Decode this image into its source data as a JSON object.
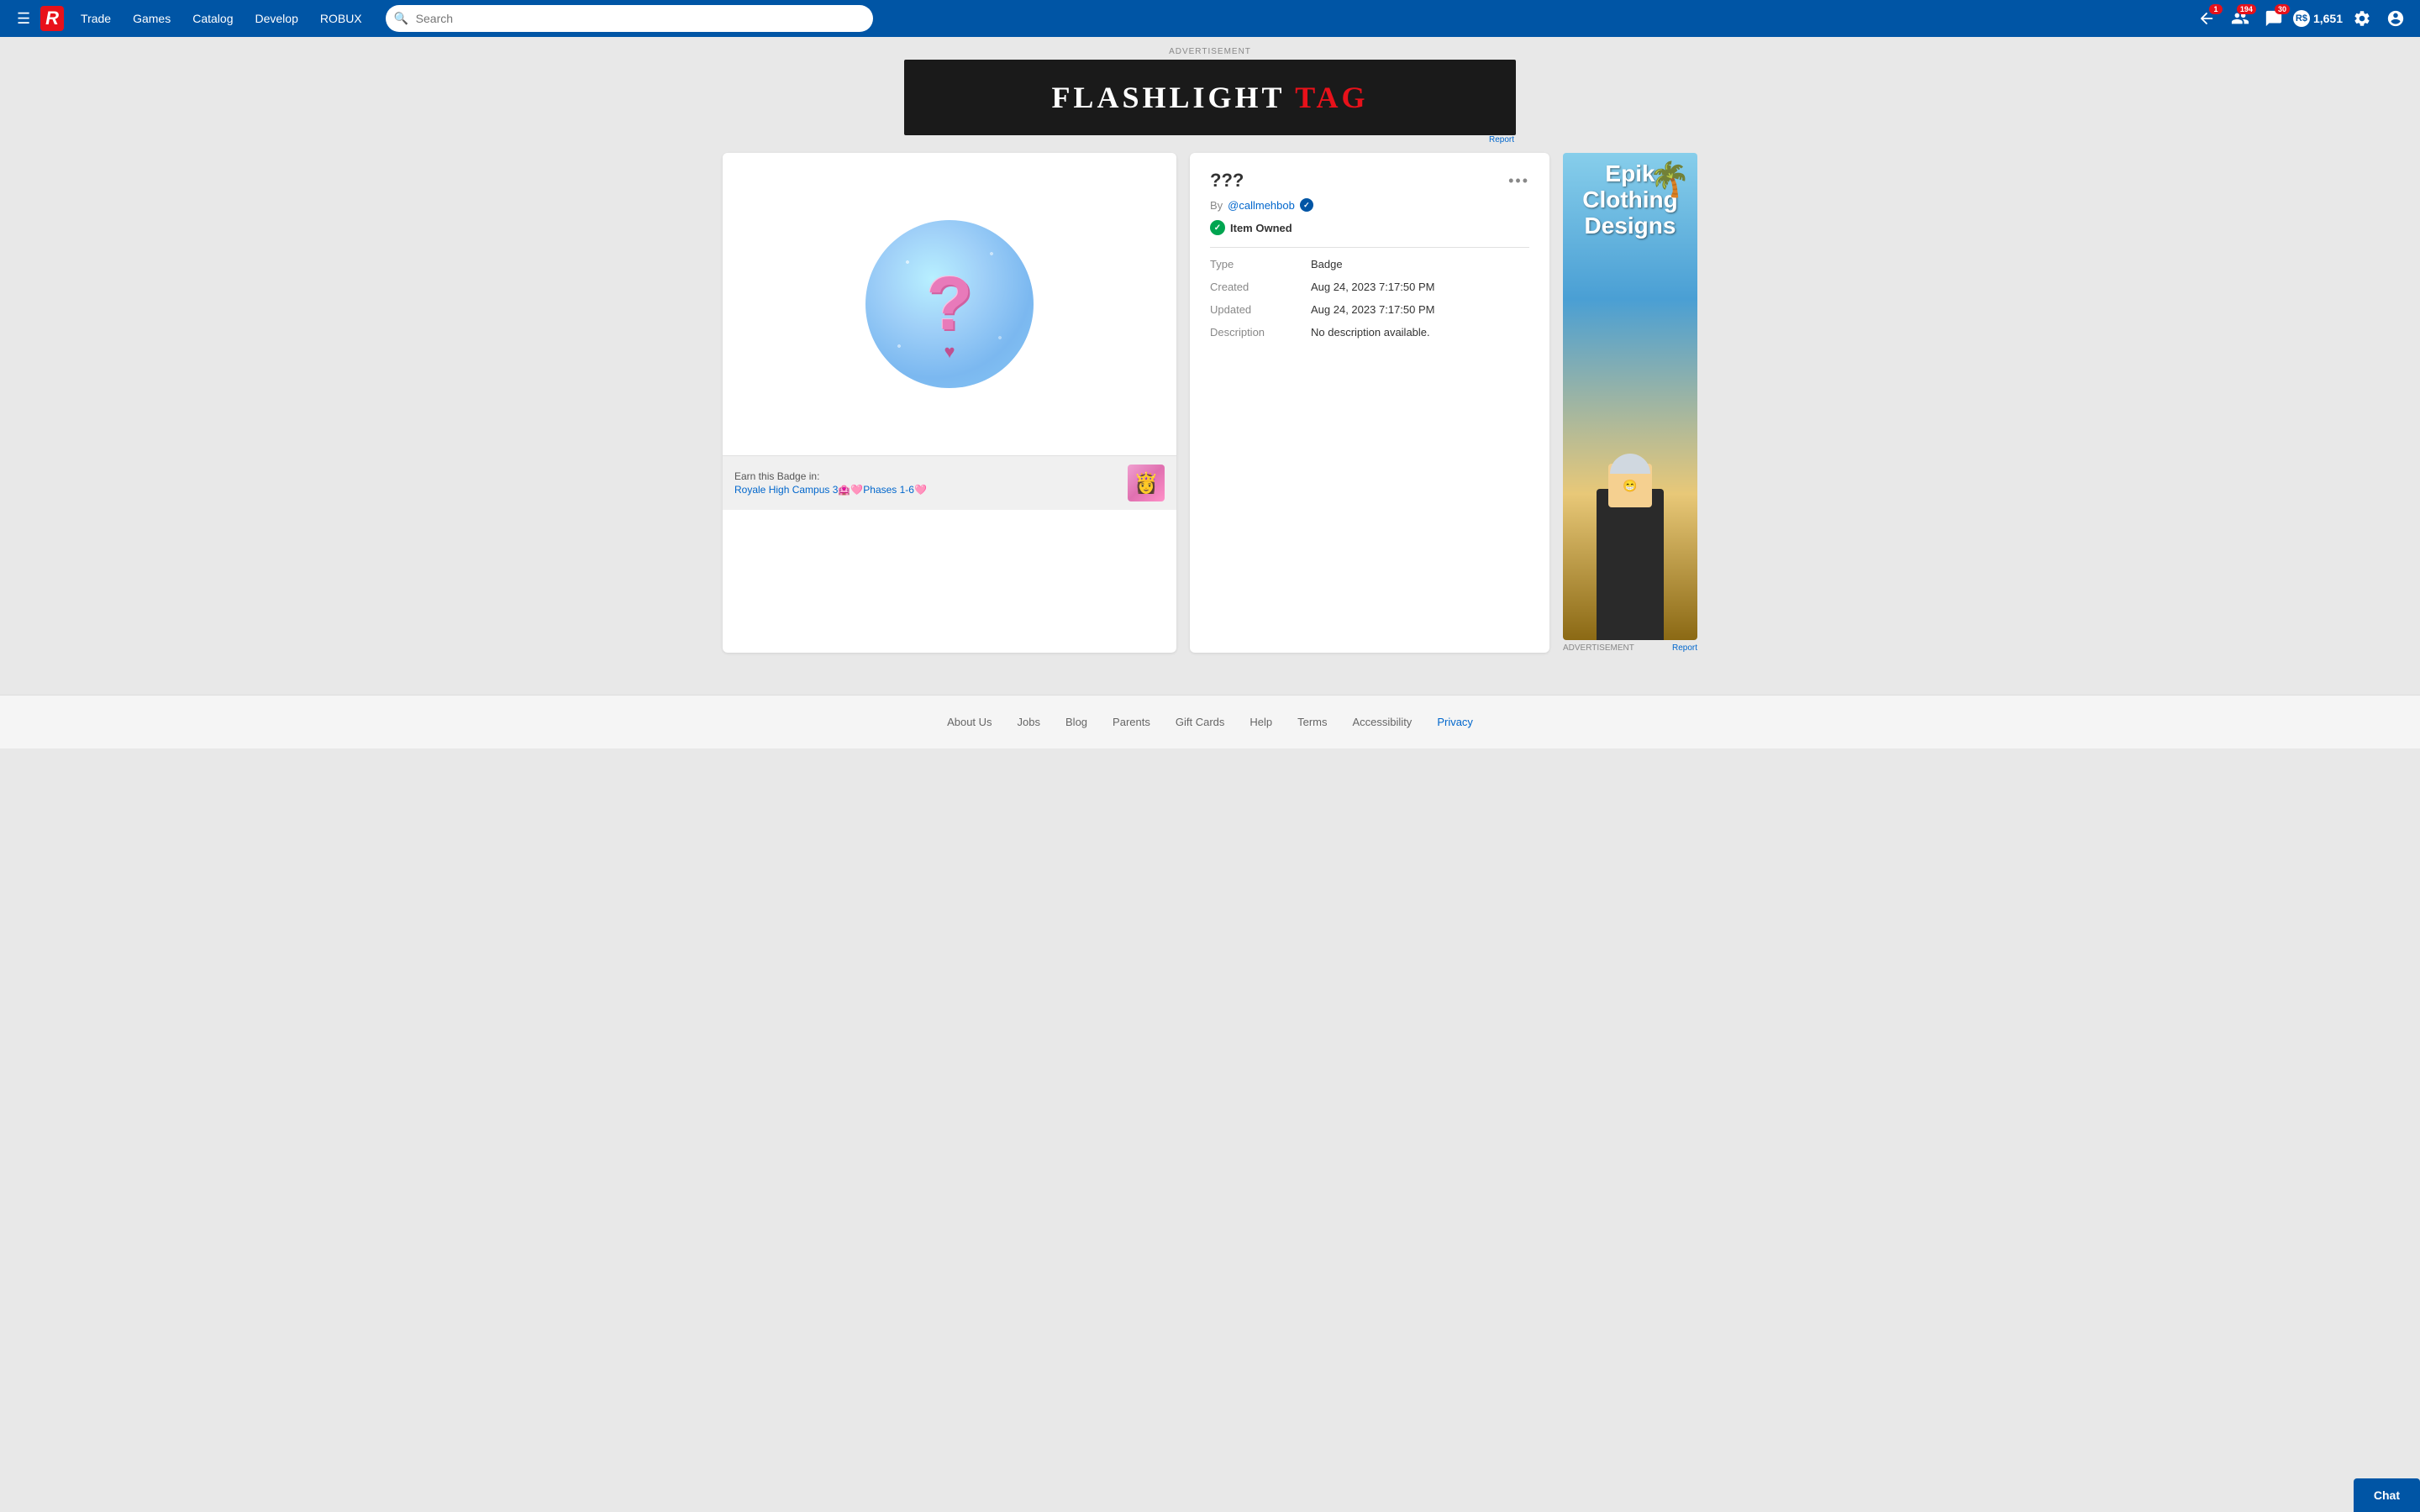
{
  "navbar": {
    "logo": "R",
    "hamburger_label": "☰",
    "links": [
      {
        "label": "Trade",
        "id": "trade"
      },
      {
        "label": "Games",
        "id": "games"
      },
      {
        "label": "Catalog",
        "id": "catalog"
      },
      {
        "label": "Develop",
        "id": "develop"
      },
      {
        "label": "ROBUX",
        "id": "robux"
      }
    ],
    "search_placeholder": "Search",
    "notifications_count_1": "1",
    "notifications_count_2": "194",
    "messages_count": "30",
    "robux_amount": "1,651"
  },
  "ad_banner": {
    "label": "ADVERTISEMENT",
    "report_label": "Report",
    "text_white": "FLASHLIGHT ",
    "text_red": "TAG"
  },
  "badge": {
    "title": "???",
    "creator_prefix": "By",
    "creator_name": "@callmehbob",
    "owned_label": "Item Owned",
    "type_label": "Type",
    "type_value": "Badge",
    "created_label": "Created",
    "created_value": "Aug 24, 2023 7:17:50 PM",
    "updated_label": "Updated",
    "updated_value": "Aug 24, 2023 7:17:50 PM",
    "description_label": "Description",
    "description_value": "No description available.",
    "earn_prefix": "Earn this Badge in:",
    "earn_game_name": "Royale High Campus 3🏩🩷Phases 1-6🩷",
    "more_options": "•••"
  },
  "sidebar_ad": {
    "label": "ADVERTISEMENT",
    "report_label": "Report",
    "title": "Epik Clothing Designs"
  },
  "footer": {
    "links": [
      {
        "label": "About Us",
        "id": "about-us"
      },
      {
        "label": "Jobs",
        "id": "jobs"
      },
      {
        "label": "Blog",
        "id": "blog"
      },
      {
        "label": "Parents",
        "id": "parents"
      },
      {
        "label": "Gift Cards",
        "id": "gift-cards"
      },
      {
        "label": "Help",
        "id": "help"
      },
      {
        "label": "Terms",
        "id": "terms"
      },
      {
        "label": "Accessibility",
        "id": "accessibility"
      },
      {
        "label": "Privacy",
        "id": "privacy",
        "active": true
      }
    ]
  },
  "chat": {
    "label": "Chat"
  }
}
